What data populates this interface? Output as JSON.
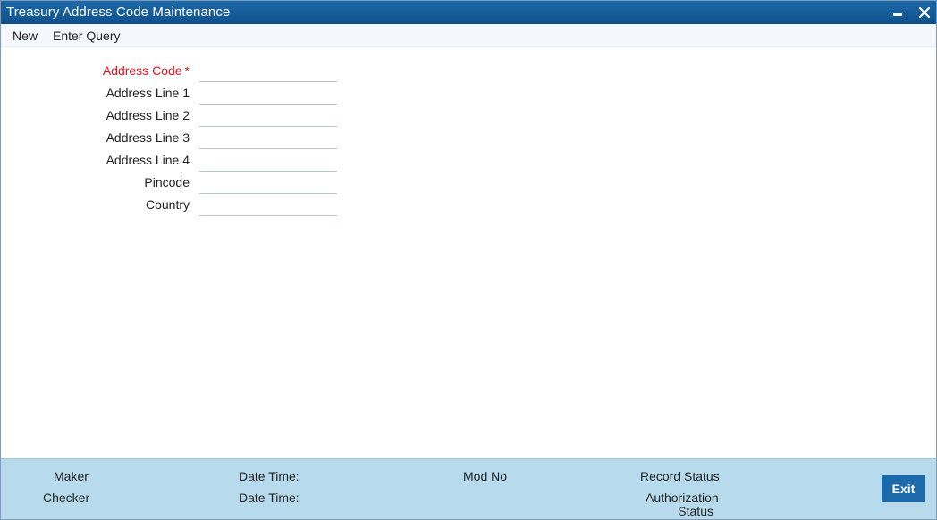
{
  "window": {
    "title": "Treasury Address Code Maintenance"
  },
  "toolbar": {
    "new_label": "New",
    "enter_query_label": "Enter Query"
  },
  "form": {
    "fields": [
      {
        "label": "Address Code",
        "required_mark": "*",
        "value": ""
      },
      {
        "label": "Address Line 1",
        "value": ""
      },
      {
        "label": "Address Line 2",
        "value": ""
      },
      {
        "label": "Address Line 3",
        "value": ""
      },
      {
        "label": "Address Line 4",
        "value": ""
      },
      {
        "label": "Pincode",
        "value": ""
      },
      {
        "label": "Country",
        "value": ""
      }
    ]
  },
  "footer": {
    "maker_label": "Maker",
    "checker_label": "Checker",
    "date_time_label_1": "Date Time:",
    "date_time_label_2": "Date Time:",
    "mod_no_label": "Mod No",
    "record_status_label": "Record Status",
    "authorization_label_line1": "Authorization",
    "authorization_label_line2": "Status",
    "exit_label": "Exit"
  },
  "colors": {
    "title_bar": "#1d6aaa",
    "footer_bg": "#b7dbed",
    "required": "#e0141e",
    "exit_button": "#1d6aaa"
  }
}
